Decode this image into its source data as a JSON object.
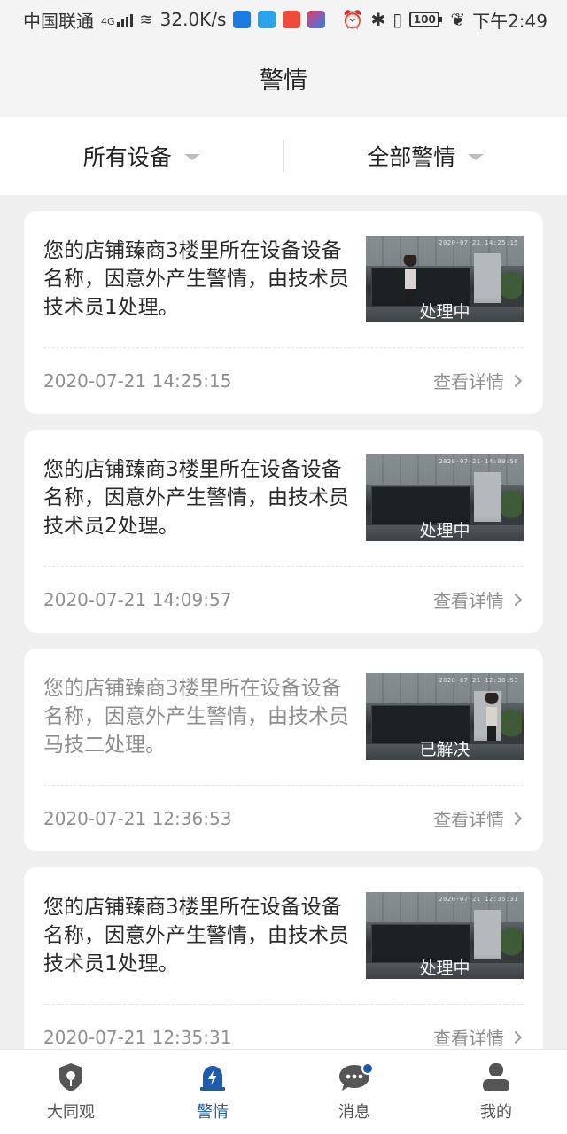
{
  "status_bar": {
    "carrier": "中国联通",
    "network": "4G",
    "speed": "32.0K/s",
    "battery": "100",
    "time": "下午2:49",
    "icons": [
      "signal-icon",
      "wifi-icon",
      "alarm-icon",
      "bluetooth-icon",
      "vibrate-icon",
      "battery-icon",
      "leaf-icon"
    ]
  },
  "header": {
    "title": "警情"
  },
  "filters": [
    {
      "label": "所有设备"
    },
    {
      "label": "全部警情"
    }
  ],
  "alerts": [
    {
      "message": "您的店铺臻商3楼里所在设备设备名称，因意外产生警情，由技术员技术员1处理。",
      "status": "处理中",
      "thumb_stamp": "2020-07-21 14:25:15",
      "time": "2020-07-21 14:25:15",
      "link": "查看详情",
      "state": "processing"
    },
    {
      "message": "您的店铺臻商3楼里所在设备设备名称，因意外产生警情，由技术员技术员2处理。",
      "status": "处理中",
      "thumb_stamp": "2020-07-21 14:09:56",
      "time": "2020-07-21 14:09:57",
      "link": "查看详情",
      "state": "processing"
    },
    {
      "message": "您的店铺臻商3楼里所在设备设备名称，因意外产生警情，由技术员马技二处理。",
      "status": "已解决",
      "thumb_stamp": "2020-07-21 12:36:53",
      "time": "2020-07-21 12:36:53",
      "link": "查看详情",
      "state": "resolved"
    },
    {
      "message": "您的店铺臻商3楼里所在设备设备名称，因意外产生警情，由技术员技术员1处理。",
      "status": "处理中",
      "thumb_stamp": "2020-07-21 12:35:31",
      "time": "2020-07-21 12:35:31",
      "link": "查看详情",
      "state": "processing"
    }
  ],
  "tabbar": {
    "items": [
      {
        "label": "大同观",
        "icon": "shield-icon"
      },
      {
        "label": "警情",
        "icon": "alarm-light-icon",
        "active": true
      },
      {
        "label": "消息",
        "icon": "chat-bubble-icon",
        "has_dot": true
      },
      {
        "label": "我的",
        "icon": "person-icon"
      }
    ]
  },
  "colors": {
    "accent": "#1e5ba8",
    "background": "#efefef",
    "card": "#ffffff",
    "muted_text": "#8f8f8f"
  }
}
